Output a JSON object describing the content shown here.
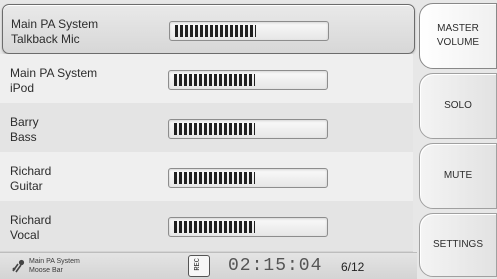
{
  "channels": [
    {
      "line1": "Main PA System",
      "line2": "Talkback Mic",
      "level": 0.55,
      "selected": true
    },
    {
      "line1": "Main PA System",
      "line2": "iPod",
      "level": 0.55,
      "selected": false
    },
    {
      "line1": "Barry",
      "line2": "Bass",
      "level": 0.55,
      "selected": false
    },
    {
      "line1": "Richard",
      "line2": "Guitar",
      "level": 0.55,
      "selected": false
    },
    {
      "line1": "Richard",
      "line2": "Vocal",
      "level": 0.55,
      "selected": false
    }
  ],
  "sidebar": {
    "master_volume": {
      "line1": "MASTER",
      "line2": "VOLUME"
    },
    "solo": "SOLO",
    "mute": "MUTE",
    "settings": "SETTINGS"
  },
  "status": {
    "icon": "instrument-icon",
    "name_line1": "Main PA System",
    "name_line2": "Moose Bar",
    "rec_label": "REC",
    "time": "02:15:04",
    "page_counter": "6/12"
  }
}
